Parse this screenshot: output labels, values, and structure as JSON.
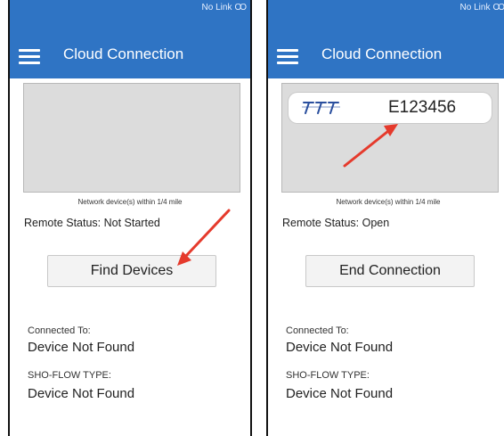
{
  "colors": {
    "appbar": "#2f74c4",
    "arrow": "#e53a2c"
  },
  "status_bar": {
    "text": "No Link",
    "icon": "infinity-link-icon"
  },
  "app_title": "Cloud Connection",
  "network_caption": "Network device(s) within 1/4 mile",
  "labels": {
    "connected_to": "Connected To:",
    "type": "SHO-FLOW TYPE:"
  },
  "screens": [
    {
      "remote_status": "Remote Status: Not Started",
      "action_button": "Find Devices",
      "connected_to_value": "Device Not Found",
      "type_value": "Device Not Found"
    },
    {
      "remote_status": "Remote Status: Open",
      "action_button": "End Connection",
      "connected_to_value": "Device Not Found",
      "type_value": "Device Not Found",
      "device": {
        "id": "E123456",
        "logo": "brand-logo"
      }
    }
  ]
}
